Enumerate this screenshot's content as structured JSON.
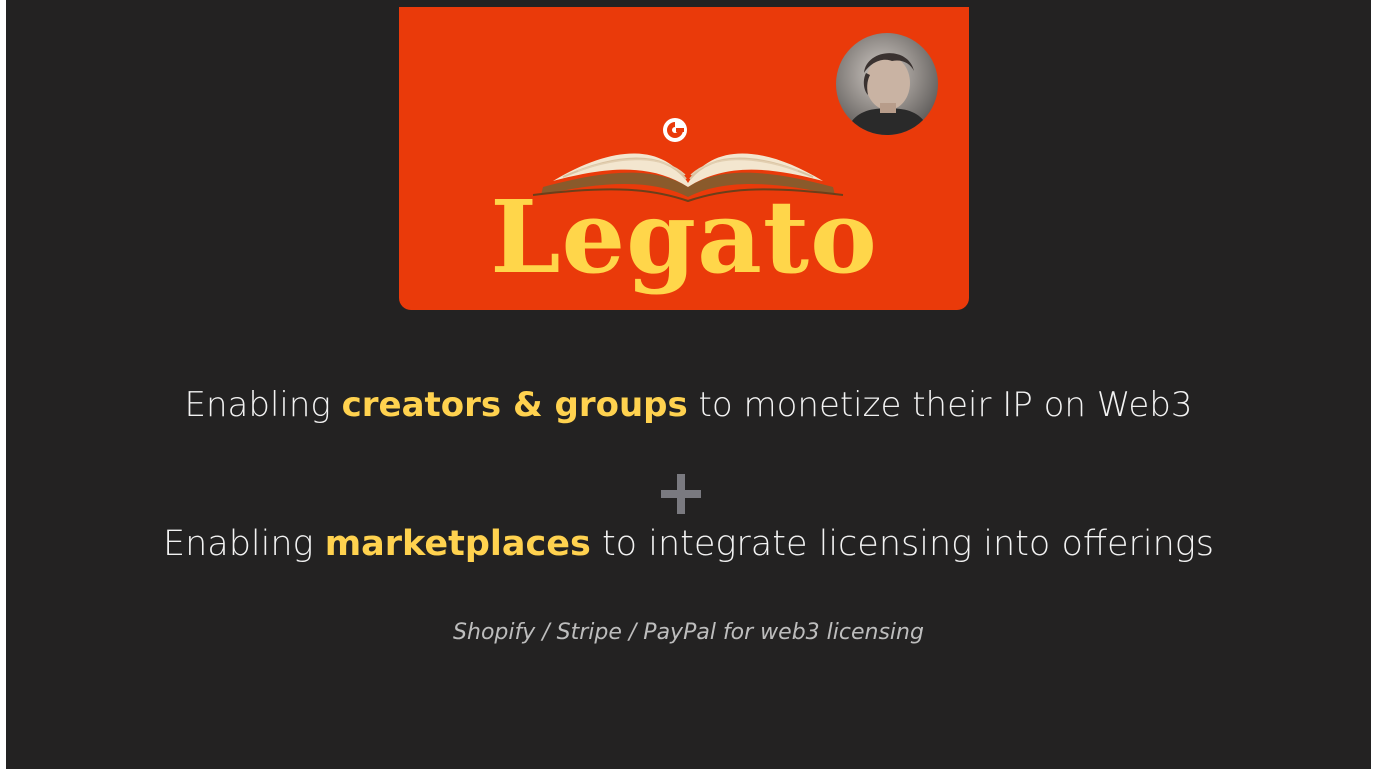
{
  "brand": {
    "wordmark": "Legato",
    "icons": {
      "coin": "coin-logo-icon",
      "book": "open-book-icon",
      "avatar": "presenter-avatar"
    },
    "colors": {
      "card_bg": "#ea3a0a",
      "wordmark": "#ffd64a",
      "highlight": "#ffd24f",
      "slide_bg": "#232222"
    }
  },
  "content": {
    "line1": {
      "prefix": "Enabling ",
      "highlight": "creators & groups",
      "suffix": " to monetize their IP on Web3"
    },
    "plus_icon": "plus-icon",
    "line2": {
      "prefix": "Enabling ",
      "highlight": "marketplaces",
      "suffix": " to integrate licensing into offerings"
    },
    "tagline": "Shopify / Stripe / PayPal for web3 licensing"
  }
}
